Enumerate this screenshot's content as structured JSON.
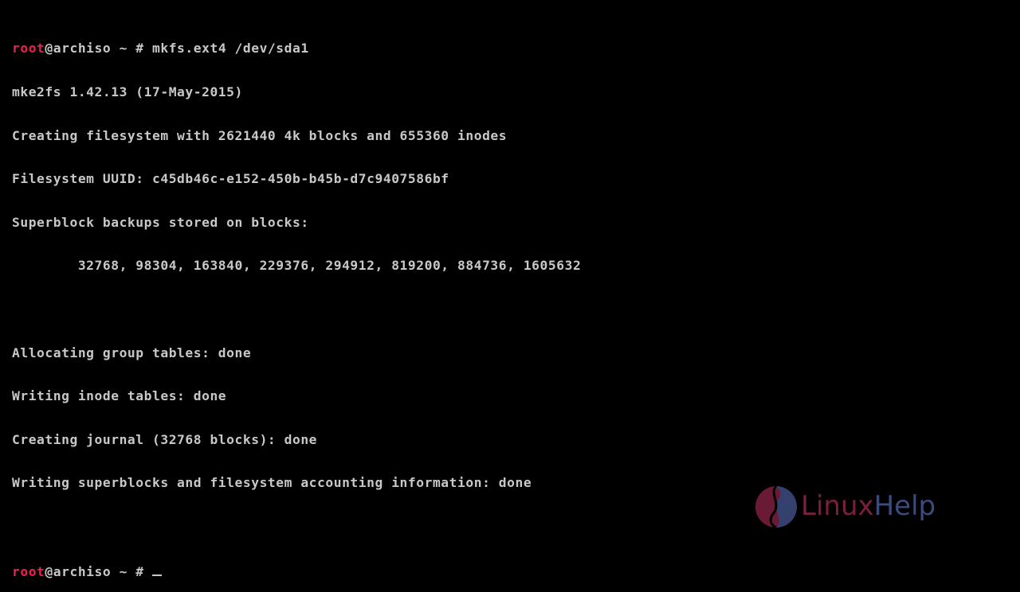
{
  "terminal": {
    "prompt_user": "root",
    "prompt_host": "@archiso ~ # ",
    "command": "mkfs.ext4 /dev/sda1",
    "output": [
      "mke2fs 1.42.13 (17-May-2015)",
      "Creating filesystem with 2621440 4k blocks and 655360 inodes",
      "Filesystem UUID: c45db46c-e152-450b-b45b-d7c9407586bf",
      "Superblock backups stored on blocks:",
      "        32768, 98304, 163840, 229376, 294912, 819200, 884736, 1605632",
      "",
      "Allocating group tables: done",
      "Writing inode tables: done",
      "Creating journal (32768 blocks): done",
      "Writing superblocks and filesystem accounting information: done",
      ""
    ]
  },
  "watermark": {
    "part1": "Linux",
    "part2": "Help",
    "color1": "#7a1f3d",
    "color2": "#3c4b7a"
  }
}
